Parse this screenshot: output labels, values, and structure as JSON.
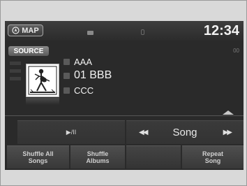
{
  "status_bar": {
    "map_label": "MAP",
    "clock": "12:34"
  },
  "source": {
    "label": "SOURCE",
    "elapsed": "00"
  },
  "track": {
    "artist": "AAA",
    "title": "01 BBB",
    "album": "CCC"
  },
  "controls": {
    "play_pause_glyph": "▶/II",
    "skip_back_glyph": "◀◀",
    "mode_label": "Song",
    "skip_forward_glyph": "▶▶"
  },
  "bottom_buttons": [
    {
      "line1": "Shuffle All",
      "line2": "Songs"
    },
    {
      "line1": "Shuffle",
      "line2": "Albums"
    },
    {
      "line1": "",
      "line2": ""
    },
    {
      "line1": "Repeat",
      "line2": "Song"
    }
  ],
  "colors": {
    "screen_bg": "#2a2a2a",
    "text": "#f2f2f2",
    "frame": "#d9d9d9"
  }
}
